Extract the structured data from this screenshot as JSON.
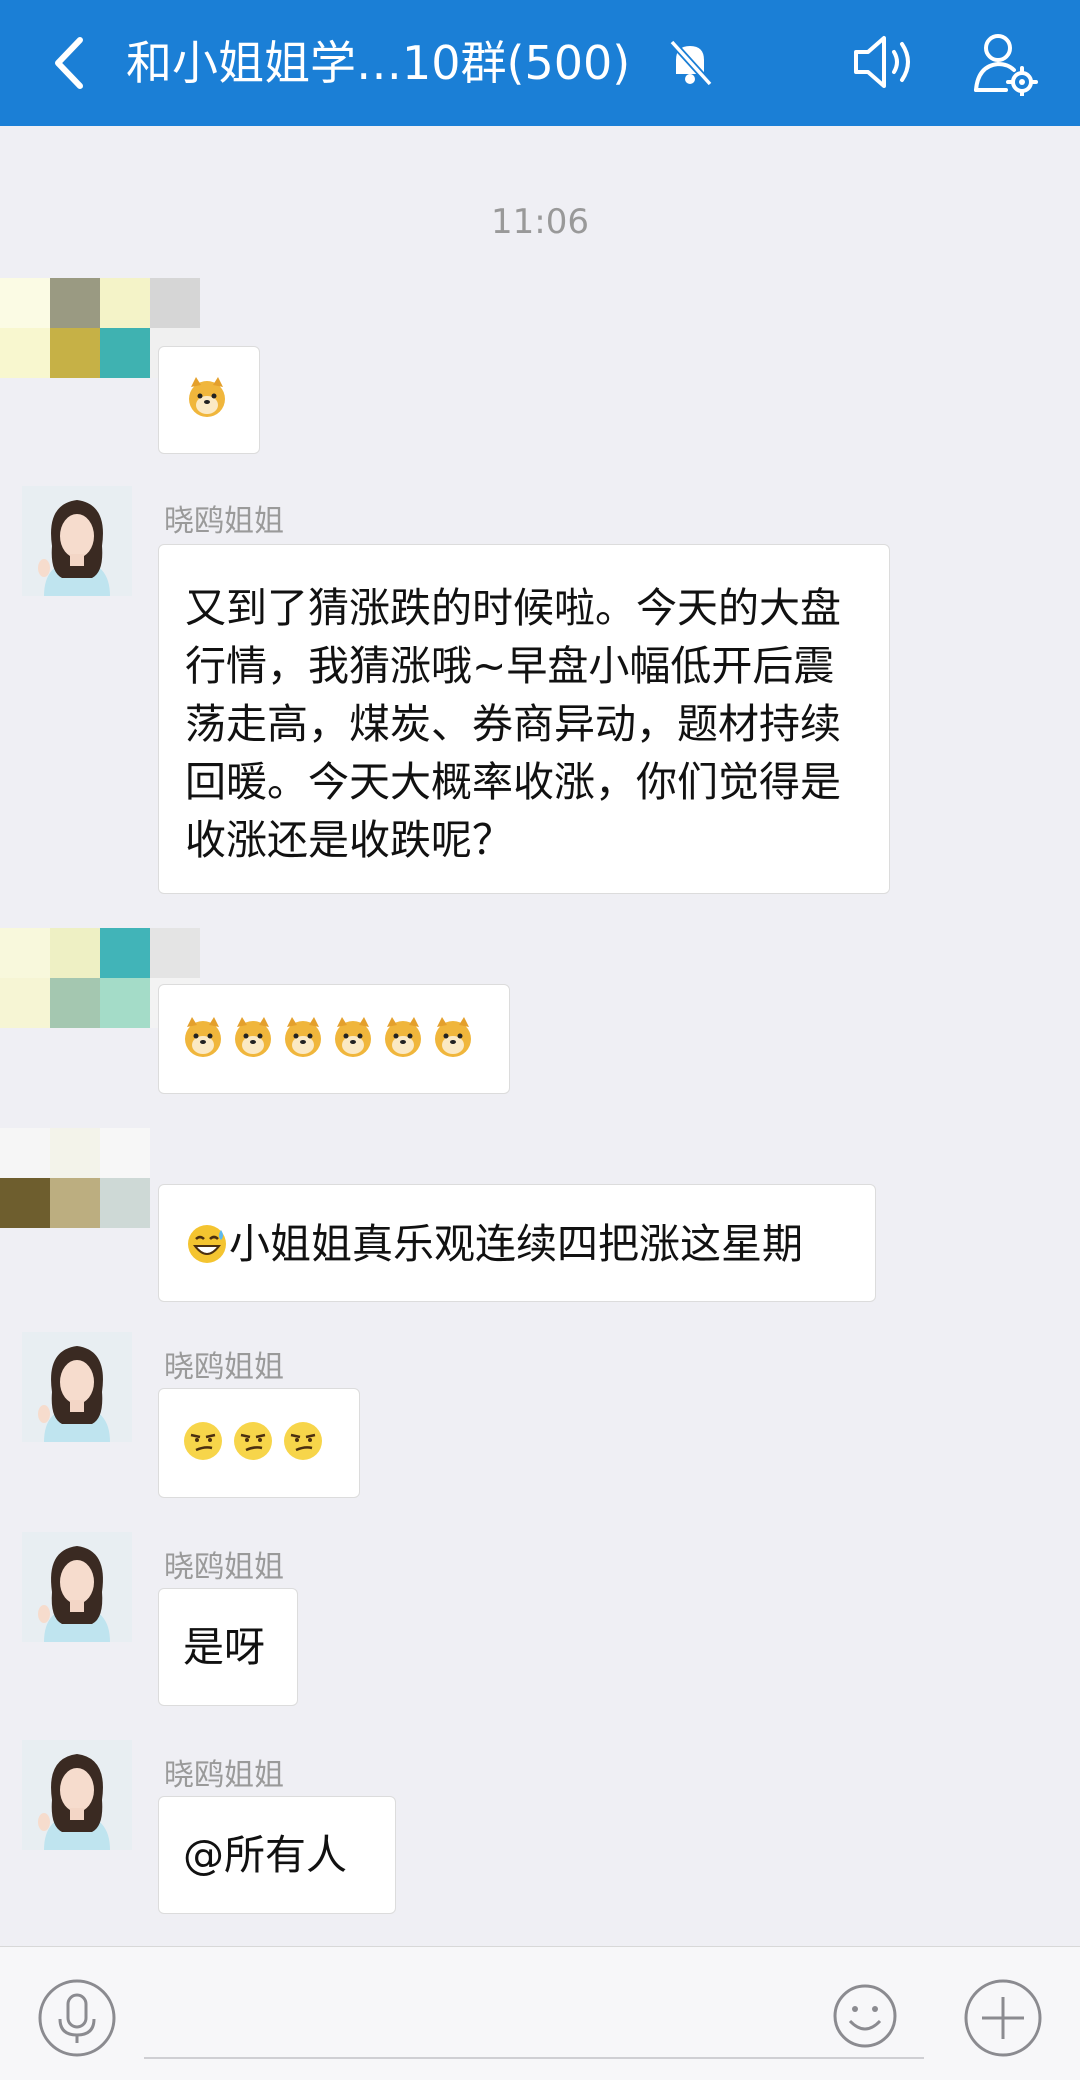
{
  "header": {
    "title": "和小姐姐学…10群(500)",
    "back_icon": "back-chevron-icon",
    "mute_icon": "bell-muted-icon",
    "speaker_icon": "speaker-icon",
    "group_settings_icon": "user-gear-icon"
  },
  "timestamp": "11:06",
  "messages": [
    {
      "sender": "",
      "text": ""
    },
    {
      "sender": "晓鸥姐姐",
      "text": "又到了猜涨跌的时候啦。今天的大盘行情，我猜涨哦~早盘小幅低开后震荡走高，煤炭、券商异动，题材持续回暖。今天大概率收涨，你们觉得是收涨还是收跌呢？"
    },
    {
      "sender": "",
      "text": ""
    },
    {
      "sender": "",
      "text": "小姐姐真乐观连续四把涨这星期"
    },
    {
      "sender": "晓鸥姐姐",
      "text": ""
    },
    {
      "sender": "晓鸥姐姐",
      "text": "是呀"
    },
    {
      "sender": "晓鸥姐姐",
      "text": "@所有人"
    }
  ],
  "input_bar": {
    "voice_icon": "microphone-icon",
    "emoji_icon": "smile-icon",
    "more_icon": "plus-icon"
  },
  "colors": {
    "header_bg": "#1b7fd6",
    "chat_bg": "#efeff4",
    "bubble_bg": "#ffffff"
  }
}
